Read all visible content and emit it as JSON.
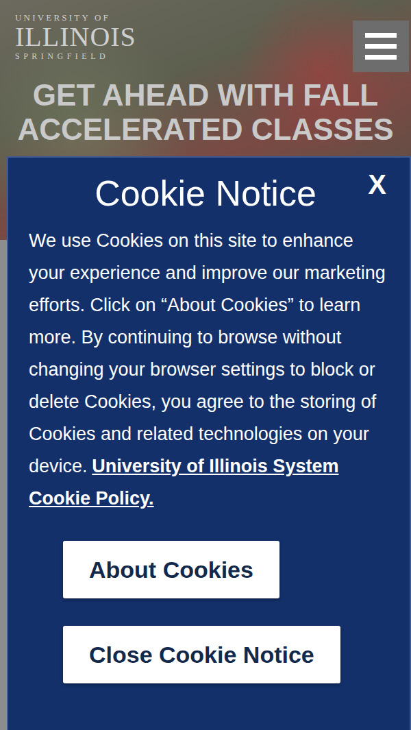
{
  "logo": {
    "line1": "UNIVERSITY OF",
    "line2": "ILLINOIS",
    "line3": "SPRINGFIELD"
  },
  "hero": {
    "headline": "GET AHEAD WITH FALL ACCELERATED CLASSES"
  },
  "cookie_notice": {
    "title": "Cookie Notice",
    "close": "X",
    "body": "We use Cookies on this site to enhance your experience and improve our marketing efforts. Click on “About Cookies” to learn more. By continuing to browse without changing your browser settings to block or delete Cookies, you agree to the storing of Cookies and related technologies on your device.",
    "link": "University of Illinois System Cookie Policy.",
    "buttons": [
      "About Cookies",
      "Close Cookie Notice"
    ]
  }
}
